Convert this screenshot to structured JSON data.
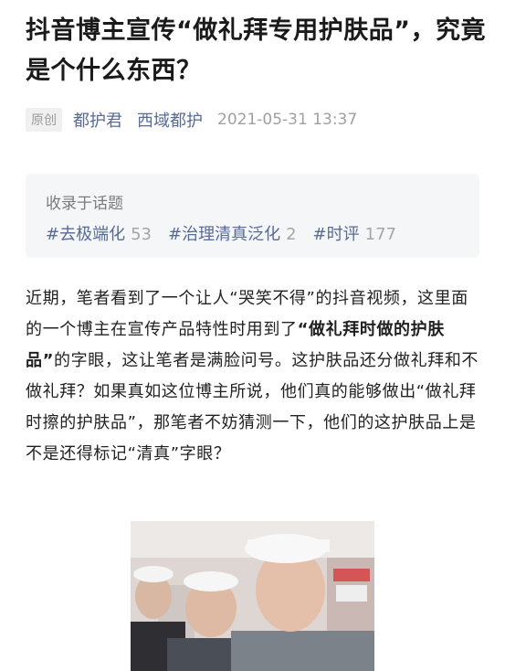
{
  "article": {
    "title": "抖音博主宣传“做礼拜专用护肤品”，究竟是个什么东西？",
    "original_tag": "原创",
    "author": "都护君",
    "account": "西域都护",
    "date": "2021-05-31 13:37",
    "topics_header": "收录于话题",
    "topics": [
      {
        "name": "#去极端化",
        "count": "53"
      },
      {
        "name": "#治理清真泛化",
        "count": "2"
      },
      {
        "name": "#时评",
        "count": "177"
      }
    ],
    "body": {
      "p1": "近期，笔者看到了一个让人“哭笑不得”的抖音视频，这里面的一个博主在宣传产品特性时用到了",
      "bold": "“做礼拜时做的护肤品”",
      "p2": "的字眼，这让笔者是满脸问号。这护肤品还分做礼拜和不做礼拜？如果真如这位博主所说，他们真的能够做出“做礼拜时擦的护肤品”，那笔者不妨猜测一下，他们的这护肤品上是不是还得标记“清真”字眼？"
    }
  },
  "colors": {
    "link": "#576b95",
    "muted": "#a0a0a0",
    "topic_bg": "#f5f6f8"
  }
}
